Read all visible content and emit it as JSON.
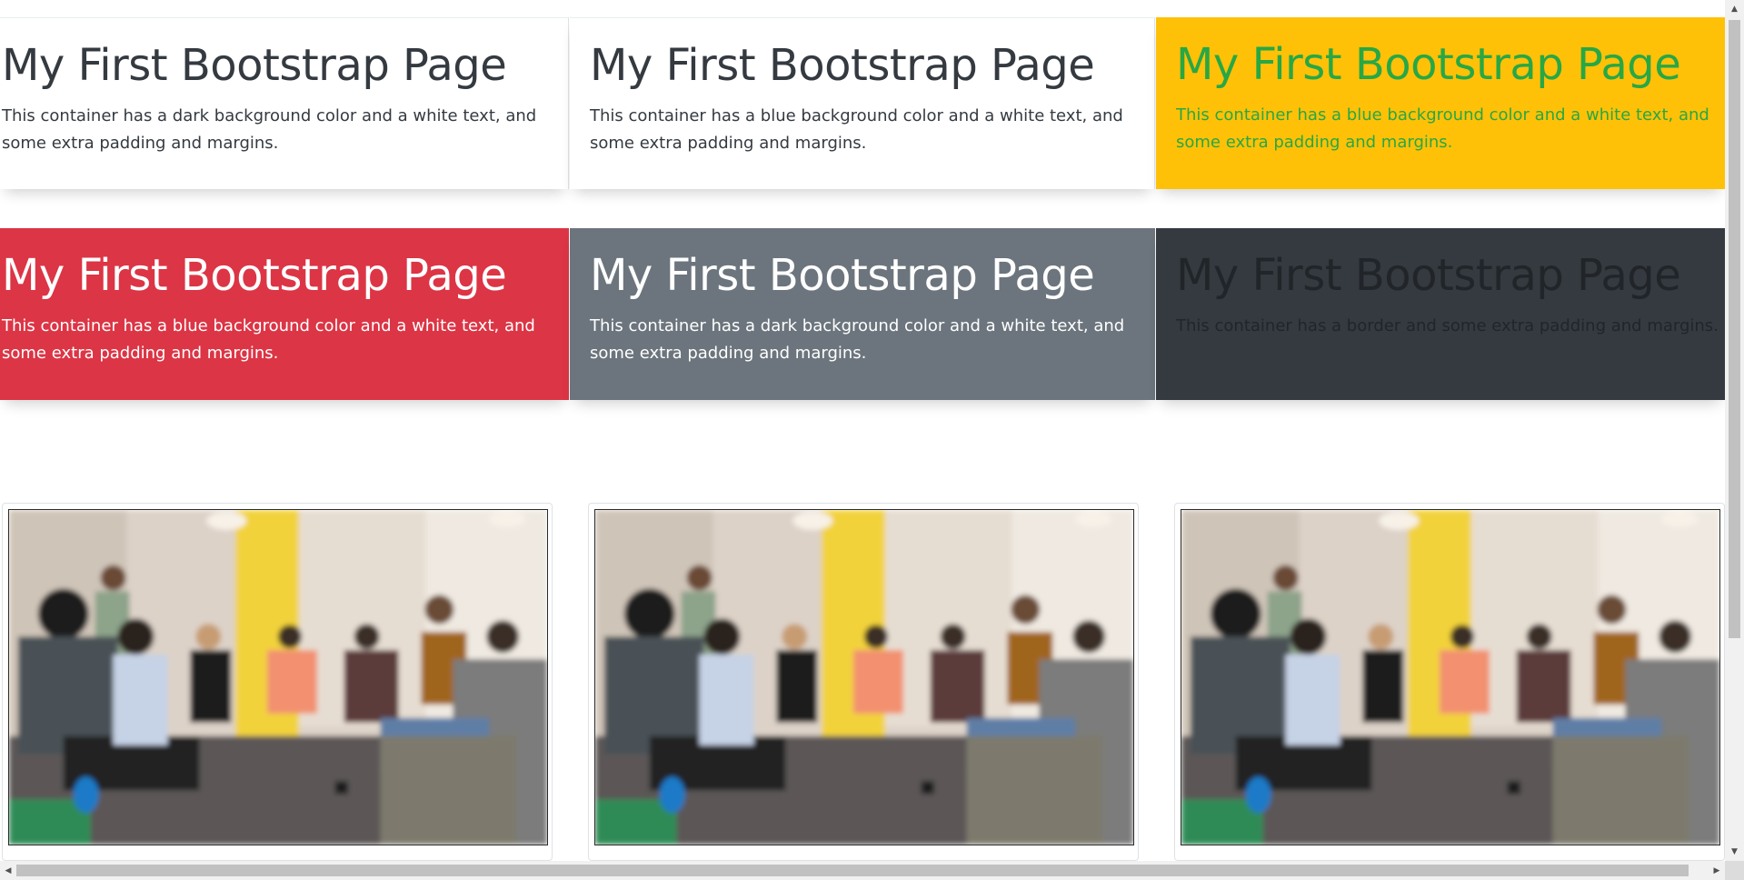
{
  "boxes": [
    {
      "title": "My First Bootstrap Page",
      "text": "This container has a dark background color and a white text, and some extra padding and margins.",
      "bg": "#ffffff",
      "color": "#343a40"
    },
    {
      "title": "My First Bootstrap Page",
      "text": "This container has a blue background color and a white text, and some extra padding and margins.",
      "bg": "#ffffff",
      "color": "#343a40"
    },
    {
      "title": "My First Bootstrap Page",
      "text": "This container has a blue background color and a white text, and some extra padding and margins.",
      "bg": "#ffc107",
      "color": "#28a745"
    },
    {
      "title": "My First Bootstrap Page",
      "text": "This container has a blue background color and a white text, and some extra padding and margins.",
      "bg": "#dc3545",
      "color": "#ffffff"
    },
    {
      "title": "My First Bootstrap Page",
      "text": "This container has a dark background color and a white text, and some extra padding and margins.",
      "bg": "#6c757d",
      "color": "#ffffff"
    },
    {
      "title": "My First Bootstrap Page",
      "text": "This container has a border and some extra padding and margins.",
      "bg": "#343a40",
      "color": "#212529"
    }
  ],
  "images": [
    {
      "alt": "team meeting photo"
    },
    {
      "alt": "team meeting photo"
    },
    {
      "alt": "team meeting photo"
    }
  ],
  "scrollbars": {
    "arrow_up": "▲",
    "arrow_down": "▼",
    "arrow_left": "◀",
    "arrow_right": "▶"
  }
}
